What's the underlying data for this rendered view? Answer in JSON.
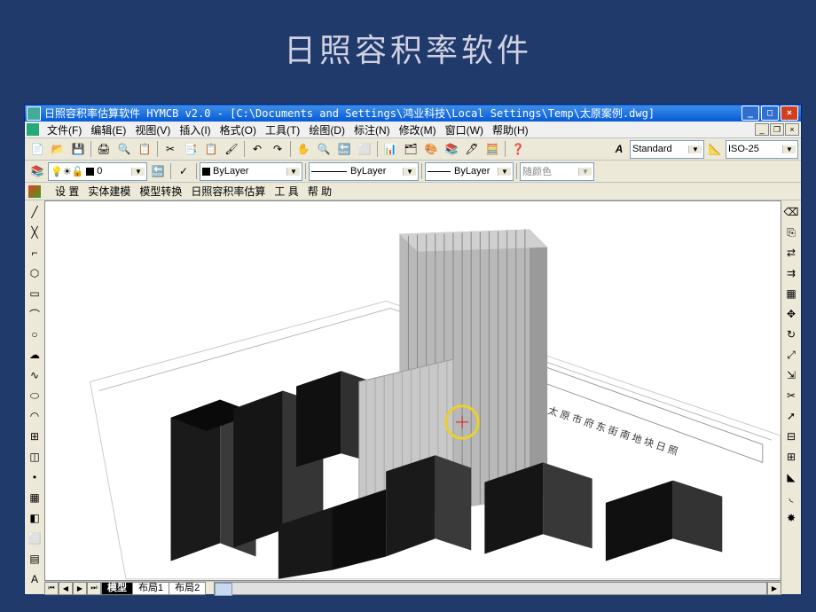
{
  "slide_title": "日照容积率软件",
  "app_title": "日照容积率估算软件 HYMCB v2.0 - [C:\\Documents and Settings\\鸿业科技\\Local Settings\\Temp\\太原案例.dwg]",
  "menu": {
    "file": "文件(F)",
    "edit": "编辑(E)",
    "view": "视图(V)",
    "insert": "插入(I)",
    "format": "格式(O)",
    "tools": "工具(T)",
    "draw": "绘图(D)",
    "dimension": "标注(N)",
    "modify": "修改(M)",
    "window": "窗口(W)",
    "help": "帮助(H)"
  },
  "toolbar2": {
    "layer": "0",
    "text_style": "Standard",
    "dim_style": "ISO-25",
    "bylayer1": "ByLayer",
    "bylayer2": "ByLayer",
    "bylayer3": "ByLayer",
    "color_combo": "随颜色"
  },
  "sub_menu": {
    "settings": "设  置",
    "solid": "实体建模",
    "convert": "模型转换",
    "calc": "日照容积率估算",
    "tool": "工  具",
    "help": "帮  助"
  },
  "tabs": {
    "model": "模型",
    "layout1": "布局1",
    "layout2": "布局2"
  }
}
